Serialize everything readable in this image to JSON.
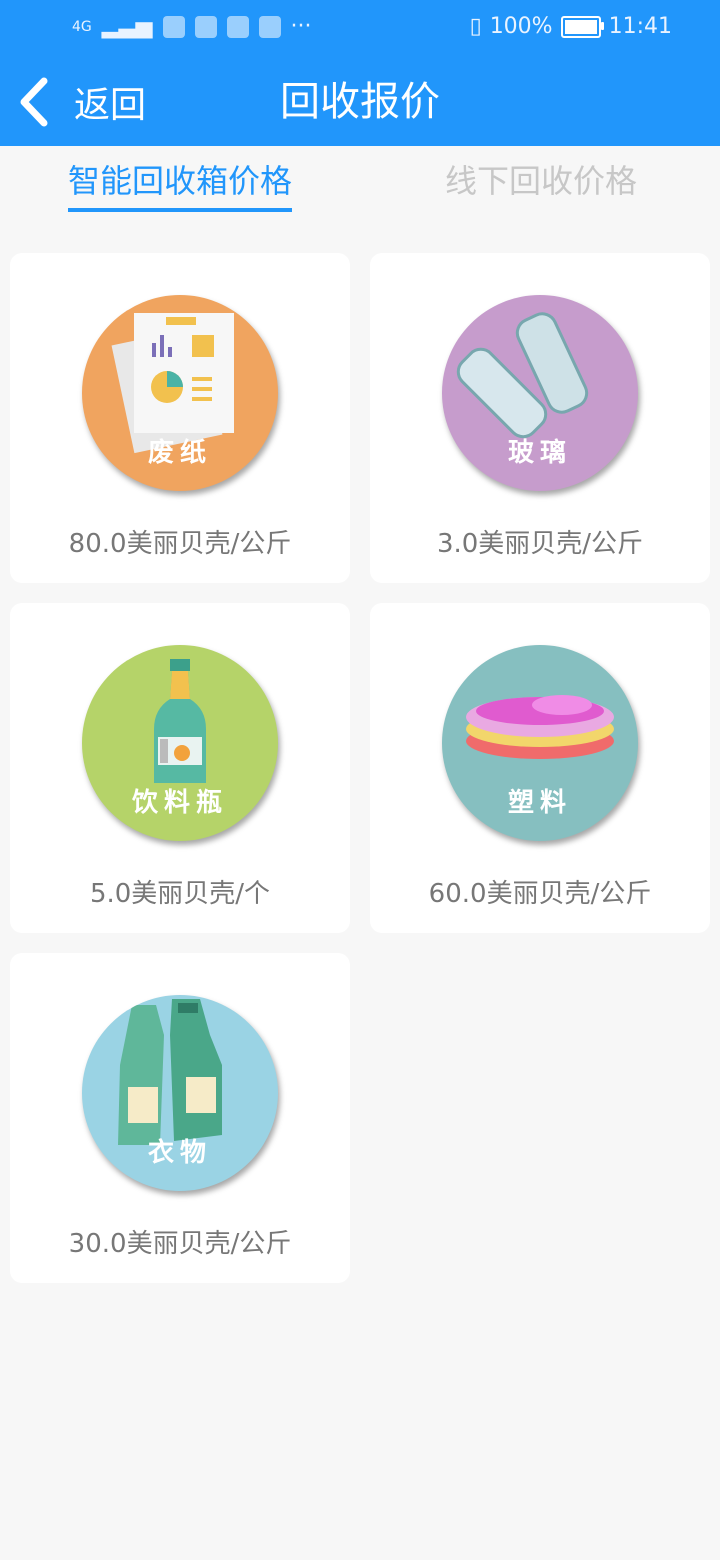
{
  "status_bar": {
    "battery": "100%",
    "time": "11:41",
    "signal": "4G"
  },
  "header": {
    "back_label": "返回",
    "title": "回收报价"
  },
  "tabs": [
    {
      "label": "智能回收箱价格"
    },
    {
      "label": "线下回收价格"
    }
  ],
  "items": [
    {
      "name": "废纸",
      "price": "80.0美丽贝壳/公斤",
      "color": "#f0a45f",
      "icon": "paper-icon"
    },
    {
      "name": "玻璃",
      "price": "3.0美丽贝壳/公斤",
      "color": "#c69ccc",
      "icon": "glass-icon"
    },
    {
      "name": "饮料瓶",
      "price": "5.0美丽贝壳/个",
      "color": "#b5d369",
      "icon": "bottle-icon"
    },
    {
      "name": "塑料",
      "price": "60.0美丽贝壳/公斤",
      "color": "#86bfc0",
      "icon": "plastic-plates-icon"
    },
    {
      "name": "衣物",
      "price": "30.0美丽贝壳/公斤",
      "color": "#9ad3e4",
      "icon": "clothes-icon"
    }
  ],
  "colors": {
    "brand": "#2196fb",
    "background": "#f7f7f7"
  }
}
